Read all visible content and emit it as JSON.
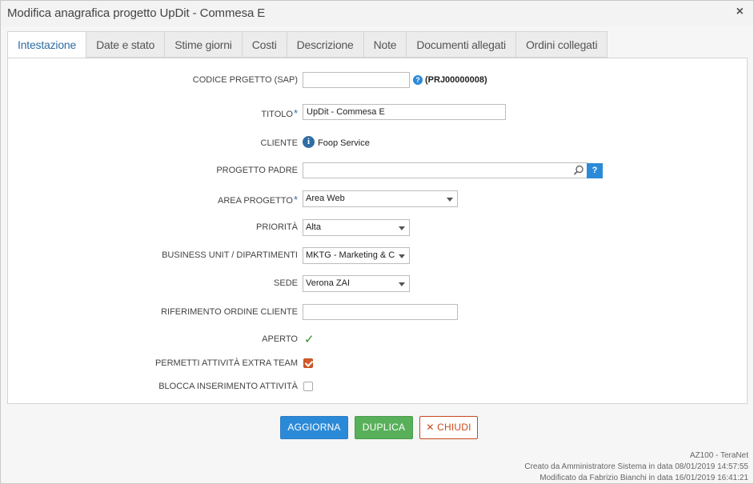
{
  "dialog": {
    "title": "Modifica anagrafica progetto UpDit - Commesa E",
    "close_glyph": "×"
  },
  "tabs": [
    {
      "label": "Intestazione",
      "active": true
    },
    {
      "label": "Date e stato"
    },
    {
      "label": "Stime giorni"
    },
    {
      "label": "Costi"
    },
    {
      "label": "Descrizione"
    },
    {
      "label": "Note"
    },
    {
      "label": "Documenti allegati"
    },
    {
      "label": "Ordini collegati"
    }
  ],
  "form": {
    "codice": {
      "label": "CODICE PRGETTO (SAP)",
      "value": "",
      "help": "?",
      "code": "(PRJ00000008)"
    },
    "titolo": {
      "label": "TITOLO",
      "required": "*",
      "value": "UpDit - Commesa E"
    },
    "cliente": {
      "label": "CLIENTE",
      "info": "i",
      "value": "Foop Service"
    },
    "progetto_padre": {
      "label": "PROGETTO PADRE",
      "value": "",
      "search_btn": "?"
    },
    "area": {
      "label": "AREA PROGETTO",
      "required": "*",
      "value": "Area Web"
    },
    "priorita": {
      "label": "PRIORITÀ",
      "value": "Alta"
    },
    "business_unit": {
      "label": "BUSINESS UNIT / DIPARTIMENTI",
      "value": "MKTG - Marketing & C"
    },
    "sede": {
      "label": "SEDE",
      "value": "Verona ZAI"
    },
    "riferimento": {
      "label": "RIFERIMENTO ORDINE CLIENTE",
      "value": ""
    },
    "aperto": {
      "label": "APERTO",
      "check": "✓"
    },
    "permetti": {
      "label": "PERMETTI ATTIVITÀ EXTRA TEAM",
      "checked": true
    },
    "blocca": {
      "label": "BLOCCA INSERIMENTO ATTIVITÀ",
      "checked": false
    }
  },
  "buttons": {
    "aggiorna": "AGGIORNA",
    "duplica": "DUPLICA",
    "chiudi": "CHIUDI",
    "chiudi_icon": "✕"
  },
  "footer": {
    "app": "AZ100 - TeraNet",
    "created": "Creato da Amministratore Sistema in data 08/01/2019 14:57:55",
    "modified": "Modificato da Fabrizio Bianchi in data 16/01/2019 16:41:21"
  },
  "colors": {
    "primary": "#2b8ad8",
    "success": "#58b05a",
    "danger": "#c94a1e",
    "check_orange": "#d15b2a"
  }
}
